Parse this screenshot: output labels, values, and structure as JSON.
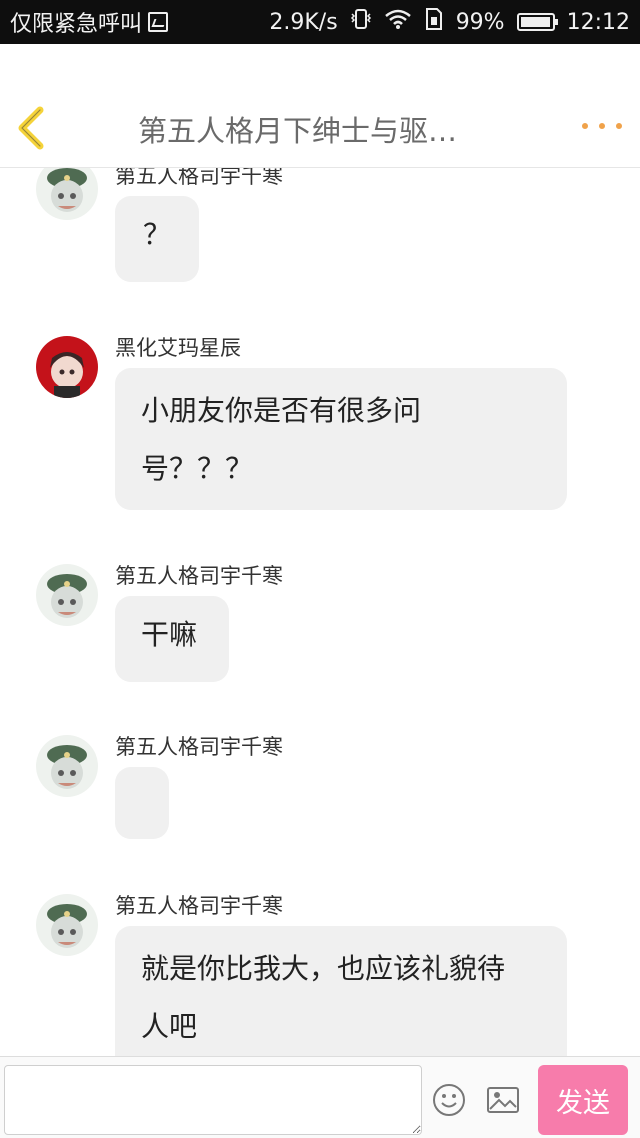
{
  "status_bar": {
    "carrier": "仅限紧急呼叫",
    "speed": "2.9K/s",
    "battery": "99%",
    "battery_level": 0.99,
    "time": "12:12"
  },
  "header": {
    "title": "第五人格月下绅士与驱…"
  },
  "messages": [
    {
      "sender": "第五人格司宇千寒",
      "text": "？",
      "avatar": "green-hat-avatar"
    },
    {
      "sender": "黑化艾玛星辰",
      "line1": "小朋友你是否有很多问",
      "line2": "号？？？",
      "avatar": "red-avatar"
    },
    {
      "sender": "第五人格司宇千寒",
      "text": "干嘛",
      "avatar": "green-hat-avatar"
    },
    {
      "sender": "第五人格司宇千寒",
      "text": "",
      "avatar": "green-hat-avatar"
    },
    {
      "sender": "第五人格司宇千寒",
      "line1": "就是你比我大，也应该礼貌待",
      "line2": "人吧",
      "avatar": "green-hat-avatar"
    }
  ],
  "input": {
    "value": "",
    "send_label": "发送"
  },
  "colors": {
    "send_button": "#f77cab",
    "more_dots": "#f0a24a",
    "back_arrow": "#f5d33a",
    "bubble": "#f0f0f0"
  }
}
